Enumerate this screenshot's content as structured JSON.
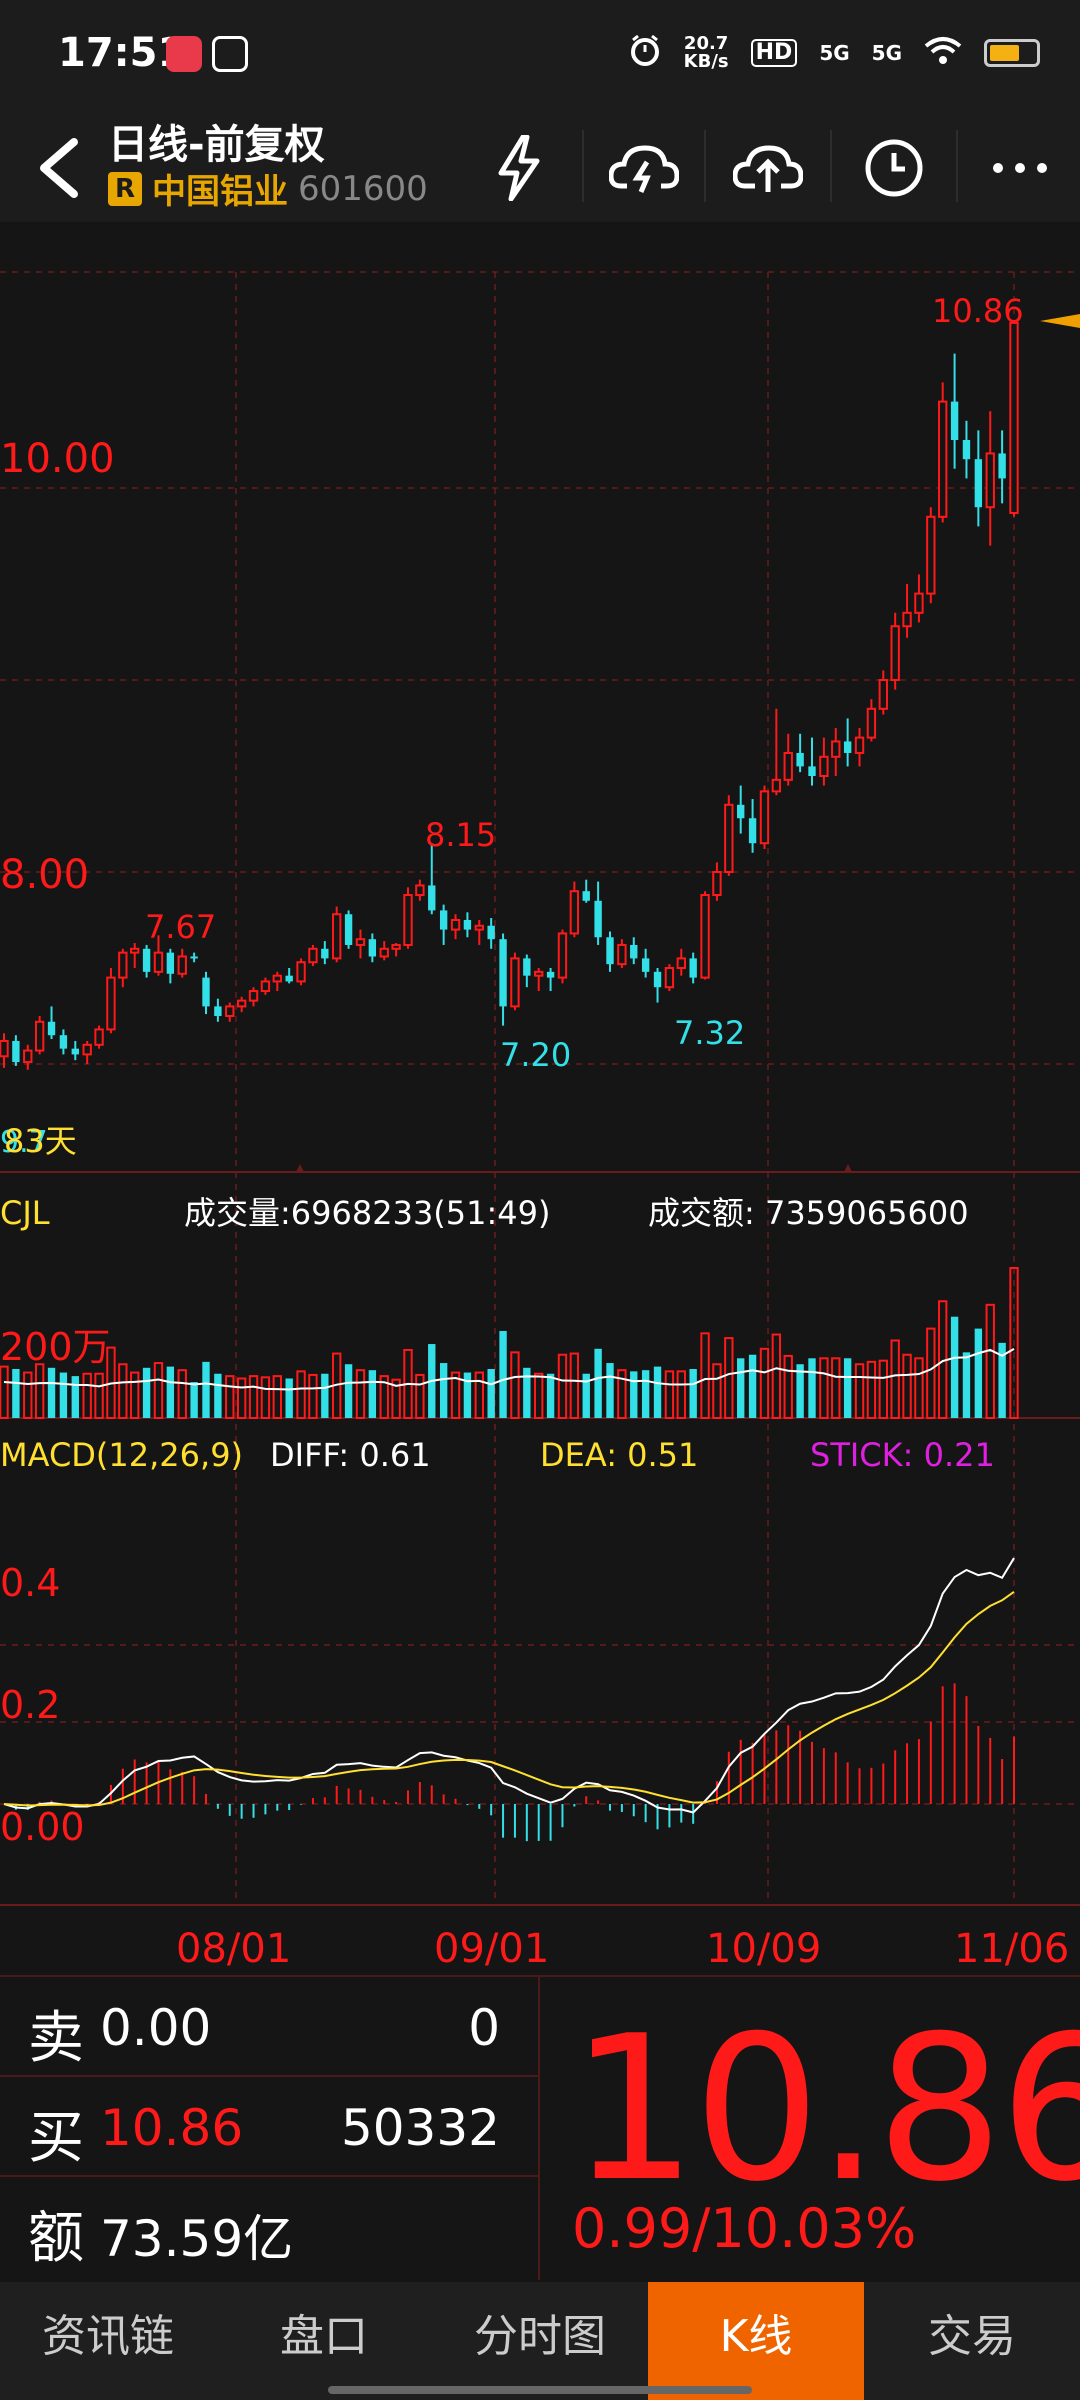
{
  "status_bar": {
    "time": "17:51",
    "speed_value": "20.7",
    "speed_unit": "KB/s",
    "hd": "HD",
    "sig1": "5G",
    "sig2": "5G"
  },
  "header": {
    "title": "日线-前复权",
    "badge": "R",
    "stock_name": "中国铝业",
    "stock_code": "601600"
  },
  "price_chart": {
    "price_axis_labels": [
      "10.00",
      "8.00"
    ],
    "high_label": "10.86",
    "annotations": [
      "7.67",
      "8.15",
      "7.20",
      "7.32"
    ],
    "days_label": "83天",
    "days_label_overlap": "9.7"
  },
  "volume_panel": {
    "label": "CJL",
    "volume_text": "成交量:6968233(51:49)",
    "amount_text": "成交额: 7359065600",
    "axis_label": "200万"
  },
  "macd_panel": {
    "title": "MACD(12,26,9)",
    "diff": "DIFF: 0.61",
    "dea": "DEA: 0.51",
    "stick": "STICK: 0.21",
    "axis_labels": [
      "0.4",
      "0.2",
      "0.00"
    ]
  },
  "date_axis": [
    "08/01",
    "09/01",
    "10/09",
    "11/06"
  ],
  "quote": {
    "sell_label": "卖",
    "sell_price": "0.00",
    "sell_qty": "0",
    "buy_label": "买",
    "buy_price": "10.86",
    "buy_qty": "50332",
    "amount_label": "额",
    "amount_value": "73.59亿",
    "last_price": "10.86",
    "change": "0.99/10.03%"
  },
  "tabs": [
    "资讯链",
    "盘口",
    "分时图",
    "K线",
    "交易"
  ],
  "colors": {
    "up": "#ff1a1a",
    "down": "#33e0e8",
    "accent": "#f06400",
    "ma_line": "#ffffff",
    "dea_line": "#ffe030",
    "stick": "#e020e0"
  },
  "chart_data": {
    "type": "candlestick",
    "ylim": [
      7.0,
      11.0
    ],
    "candles": [
      [
        7.04,
        7.16,
        6.98,
        7.12
      ],
      [
        7.12,
        7.15,
        6.99,
        7.01
      ],
      [
        7.01,
        7.1,
        6.97,
        7.07
      ],
      [
        7.07,
        7.25,
        7.05,
        7.22
      ],
      [
        7.22,
        7.3,
        7.13,
        7.15
      ],
      [
        7.15,
        7.18,
        7.05,
        7.08
      ],
      [
        7.08,
        7.12,
        7.02,
        7.05
      ],
      [
        7.05,
        7.12,
        7.0,
        7.1
      ],
      [
        7.1,
        7.2,
        7.08,
        7.18
      ],
      [
        7.18,
        7.5,
        7.16,
        7.45
      ],
      [
        7.45,
        7.6,
        7.4,
        7.58
      ],
      [
        7.58,
        7.63,
        7.5,
        7.6
      ],
      [
        7.6,
        7.62,
        7.45,
        7.48
      ],
      [
        7.48,
        7.67,
        7.46,
        7.58
      ],
      [
        7.58,
        7.6,
        7.42,
        7.47
      ],
      [
        7.47,
        7.6,
        7.45,
        7.56
      ],
      [
        7.56,
        7.58,
        7.53,
        7.55
      ],
      [
        7.45,
        7.48,
        7.26,
        7.3
      ],
      [
        7.3,
        7.34,
        7.22,
        7.25
      ],
      [
        7.25,
        7.32,
        7.22,
        7.3
      ],
      [
        7.3,
        7.35,
        7.27,
        7.33
      ],
      [
        7.33,
        7.4,
        7.3,
        7.38
      ],
      [
        7.38,
        7.45,
        7.36,
        7.43
      ],
      [
        7.43,
        7.48,
        7.38,
        7.46
      ],
      [
        7.46,
        7.5,
        7.42,
        7.43
      ],
      [
        7.43,
        7.55,
        7.41,
        7.53
      ],
      [
        7.53,
        7.62,
        7.51,
        7.6
      ],
      [
        7.6,
        7.64,
        7.52,
        7.55
      ],
      [
        7.55,
        7.82,
        7.53,
        7.78
      ],
      [
        7.78,
        7.8,
        7.6,
        7.62
      ],
      [
        7.62,
        7.7,
        7.55,
        7.65
      ],
      [
        7.65,
        7.68,
        7.53,
        7.56
      ],
      [
        7.56,
        7.64,
        7.54,
        7.6
      ],
      [
        7.6,
        7.63,
        7.56,
        7.62
      ],
      [
        7.62,
        7.92,
        7.6,
        7.88
      ],
      [
        7.88,
        7.96,
        7.85,
        7.93
      ],
      [
        7.93,
        8.15,
        7.78,
        7.8
      ],
      [
        7.8,
        7.83,
        7.62,
        7.7
      ],
      [
        7.7,
        7.78,
        7.65,
        7.75
      ],
      [
        7.75,
        7.79,
        7.66,
        7.7
      ],
      [
        7.7,
        7.75,
        7.62,
        7.72
      ],
      [
        7.72,
        7.76,
        7.6,
        7.65
      ],
      [
        7.65,
        7.68,
        7.2,
        7.3
      ],
      [
        7.3,
        7.58,
        7.28,
        7.55
      ],
      [
        7.55,
        7.57,
        7.4,
        7.46
      ],
      [
        7.46,
        7.5,
        7.38,
        7.48
      ],
      [
        7.48,
        7.5,
        7.38,
        7.45
      ],
      [
        7.45,
        7.7,
        7.42,
        7.68
      ],
      [
        7.68,
        7.95,
        7.66,
        7.9
      ],
      [
        7.9,
        7.96,
        7.84,
        7.85
      ],
      [
        7.85,
        7.95,
        7.62,
        7.66
      ],
      [
        7.66,
        7.69,
        7.48,
        7.52
      ],
      [
        7.52,
        7.65,
        7.5,
        7.62
      ],
      [
        7.62,
        7.66,
        7.52,
        7.55
      ],
      [
        7.55,
        7.6,
        7.45,
        7.48
      ],
      [
        7.48,
        7.5,
        7.32,
        7.4
      ],
      [
        7.4,
        7.52,
        7.38,
        7.5
      ],
      [
        7.5,
        7.6,
        7.46,
        7.55
      ],
      [
        7.55,
        7.58,
        7.42,
        7.45
      ],
      [
        7.45,
        7.9,
        7.44,
        7.88
      ],
      [
        7.88,
        8.05,
        7.85,
        8.0
      ],
      [
        8.0,
        8.4,
        7.98,
        8.35
      ],
      [
        8.35,
        8.45,
        8.2,
        8.28
      ],
      [
        8.28,
        8.38,
        8.1,
        8.15
      ],
      [
        8.15,
        8.45,
        8.12,
        8.42
      ],
      [
        8.42,
        8.85,
        8.4,
        8.48
      ],
      [
        8.48,
        8.72,
        8.45,
        8.62
      ],
      [
        8.62,
        8.72,
        8.52,
        8.55
      ],
      [
        8.55,
        8.7,
        8.45,
        8.5
      ],
      [
        8.5,
        8.7,
        8.45,
        8.6
      ],
      [
        8.6,
        8.75,
        8.5,
        8.68
      ],
      [
        8.68,
        8.8,
        8.55,
        8.62
      ],
      [
        8.62,
        8.75,
        8.55,
        8.7
      ],
      [
        8.7,
        8.9,
        8.68,
        8.85
      ],
      [
        8.85,
        9.05,
        8.82,
        9.0
      ],
      [
        9.0,
        9.35,
        8.95,
        9.28
      ],
      [
        9.28,
        9.5,
        9.22,
        9.35
      ],
      [
        9.35,
        9.55,
        9.3,
        9.45
      ],
      [
        9.45,
        9.9,
        9.4,
        9.85
      ],
      [
        9.85,
        10.55,
        9.82,
        10.45
      ],
      [
        10.45,
        10.7,
        10.1,
        10.25
      ],
      [
        10.25,
        10.35,
        10.05,
        10.15
      ],
      [
        10.15,
        10.3,
        9.8,
        9.9
      ],
      [
        9.9,
        10.4,
        9.7,
        10.18
      ],
      [
        10.18,
        10.3,
        9.92,
        10.05
      ],
      [
        9.87,
        10.86,
        9.85,
        10.86
      ]
    ],
    "volume_axis_label": "200万",
    "macd_ylim": [
      -0.1,
      0.7
    ]
  }
}
